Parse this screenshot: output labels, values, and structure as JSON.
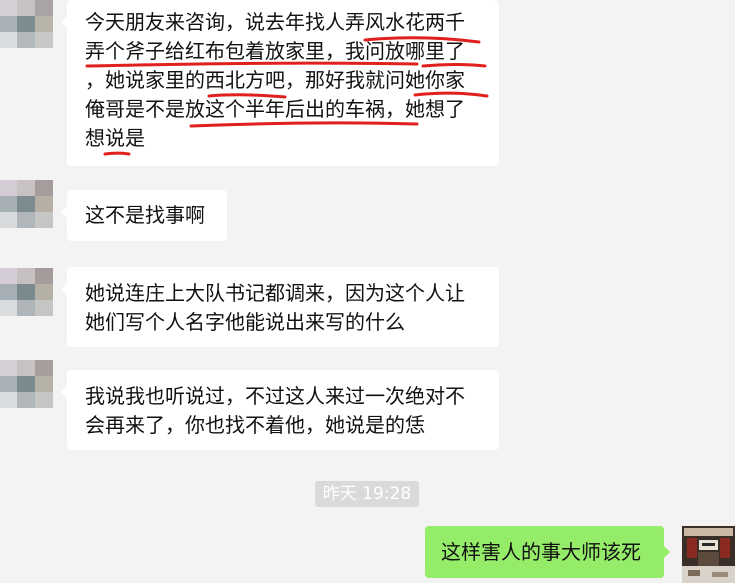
{
  "messages": [
    {
      "lines": [
        "今天朋友来咨询，说去年找人弄风水花两千",
        "弄个斧子给红布包着放家里，我问放哪里了",
        "，她说家里的西北方吧，那好我就问她你家",
        "俺哥是不是放这个半年后出的车祸，她想了",
        "想说是"
      ]
    },
    {
      "lines": [
        "这不是找事啊"
      ]
    },
    {
      "lines": [
        "她说连庄上大队书记都调来，因为这个人让",
        "她们写个人名字他能说出来写的什么"
      ]
    },
    {
      "lines": [
        "我说我也听说过，不过这人来过一次绝对不",
        "会再来了，你也找不着他，她说是的恁"
      ]
    }
  ],
  "timestamp": "昨天 19:28",
  "my_message": "这样害人的事大师该死",
  "colors": {
    "background": "#f3f3f3",
    "bubble_other": "#ffffff",
    "bubble_me": "#95ec69",
    "underline": "#e0201c"
  }
}
